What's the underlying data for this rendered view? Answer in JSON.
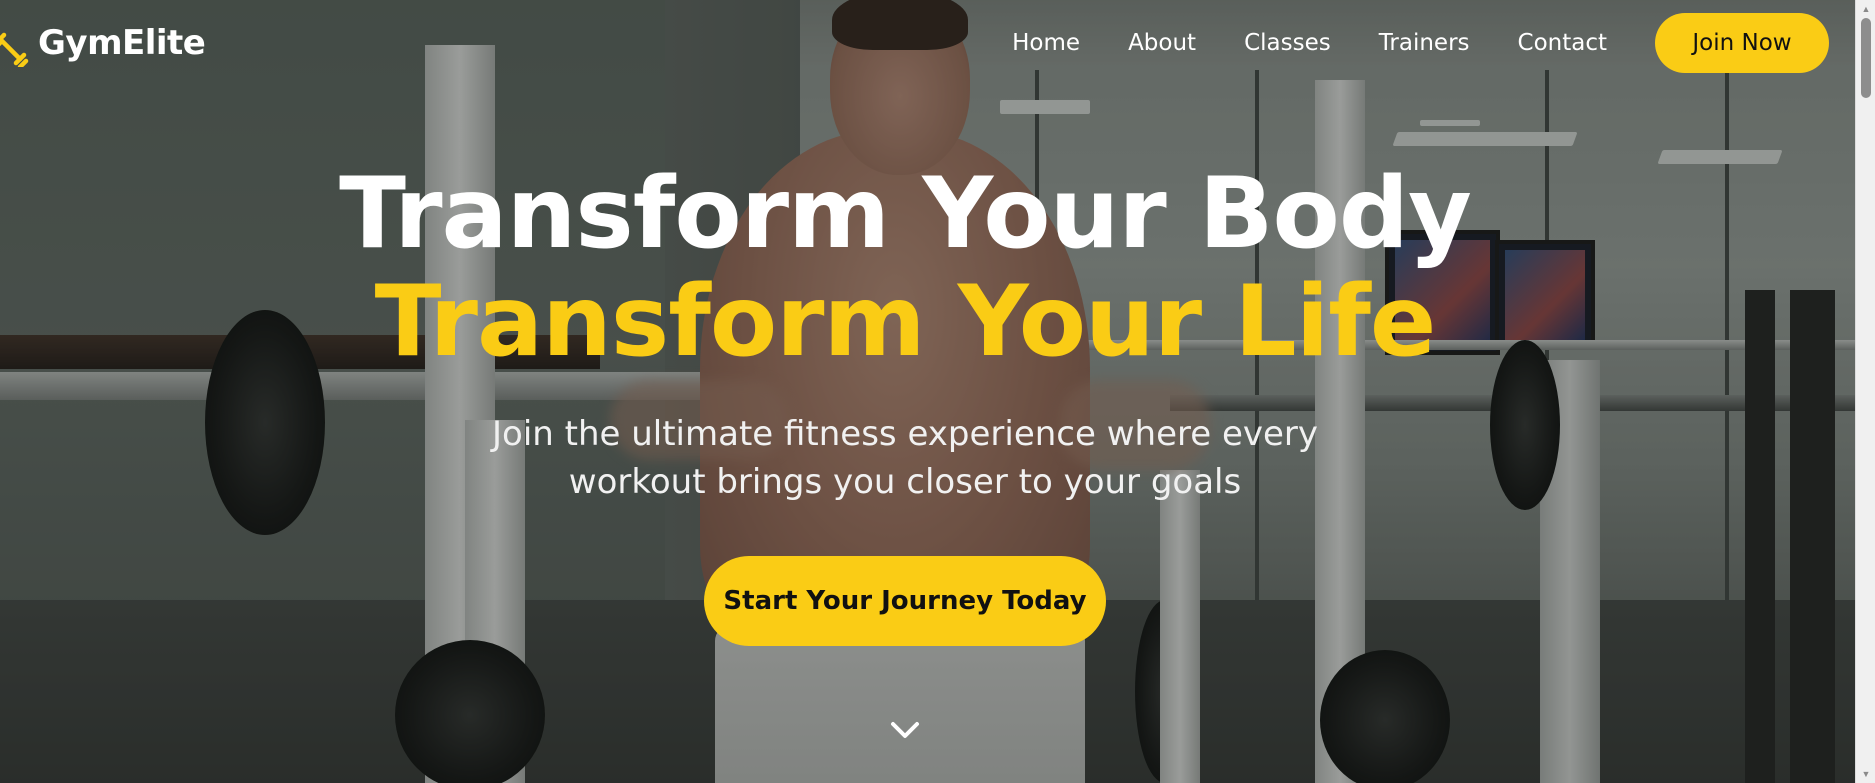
{
  "brand": {
    "name": "GymElite",
    "icon": "dumbbell-icon",
    "accent_color": "#facc15"
  },
  "nav": {
    "links": [
      "Home",
      "About",
      "Classes",
      "Trainers",
      "Contact"
    ],
    "join_label": "Join Now"
  },
  "hero": {
    "headline_line1": "Transform Your Body",
    "headline_line2": "Transform Your Life",
    "subtitle": "Join the ultimate fitness experience where every workout brings you closer to your goals",
    "cta_label": "Start Your Journey Today",
    "scroll_icon": "chevron-down-icon"
  },
  "colors": {
    "accent": "#facc15",
    "text_primary": "#ffffff",
    "button_text": "#111111"
  }
}
